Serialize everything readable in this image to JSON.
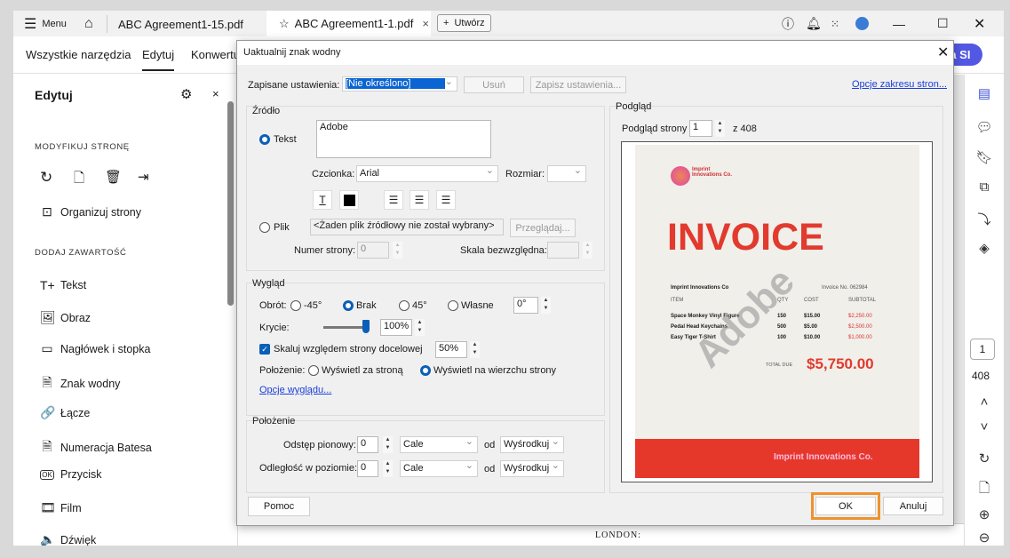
{
  "tabbar": {
    "menu": "Menu",
    "tabs": [
      {
        "label": "ABC Agreement1-15.pdf"
      },
      {
        "label": "ABC Agreement1-1.pdf"
      }
    ],
    "create": "Utwórz"
  },
  "toolbar": {
    "all_tools": "Wszystkie narzędzia",
    "edit": "Edytuj",
    "convert": "Konwertuj",
    "ai": "ta SI"
  },
  "sidebar": {
    "title": "Edytuj",
    "modify_header": "MODYFIKUJ STRONĘ",
    "organize": "Organizuj strony",
    "add_header": "DODAJ ZAWARTOŚĆ",
    "items": [
      {
        "label": "Tekst",
        "icon": "T+"
      },
      {
        "label": "Obraz",
        "icon": "🖼"
      },
      {
        "label": "Nagłówek i stopka",
        "icon": "▭"
      },
      {
        "label": "Znak wodny",
        "icon": "🗎"
      },
      {
        "label": "Łącze",
        "icon": "🔗"
      },
      {
        "label": "Numeracja Batesa",
        "icon": "🗎"
      },
      {
        "label": "Przycisk",
        "icon": "OK"
      },
      {
        "label": "Film",
        "icon": "🎞"
      },
      {
        "label": "Dźwięk",
        "icon": "🔈"
      }
    ]
  },
  "rail": {
    "page": "1",
    "total": "408"
  },
  "document": {
    "footer_text": "LONDON:"
  },
  "dialog": {
    "title": "Uaktualnij znak wodny",
    "saved_label": "Zapisane ustawienia:",
    "saved_value": "[Nie określono]",
    "delete": "Usuń",
    "save_settings": "Zapisz ustawienia...",
    "page_range_link": "Opcje zakresu stron...",
    "source": {
      "title": "Źródło",
      "text_label": "Tekst",
      "text_value": "Adobe",
      "font_label": "Czcionka:",
      "font_value": "Arial",
      "size_label": "Rozmiar:",
      "size_value": "",
      "file_label": "Plik",
      "file_value": "<Żaden plik źródłowy nie został wybrany>",
      "browse": "Przeglądaj...",
      "page_num_label": "Numer strony:",
      "page_num_value": "0",
      "scale_label": "Skala bezwzględna:",
      "scale_value": ""
    },
    "appearance": {
      "title": "Wygląd",
      "rotation_label": "Obrót:",
      "rot_options": [
        "-45°",
        "Brak",
        "45°",
        "Własne"
      ],
      "rot_custom": "0°",
      "opacity_label": "Krycie:",
      "opacity_value": "100%",
      "opacity": 1.0,
      "scale_label": "Skaluj względem strony docelowej",
      "scale_value": "50%",
      "position_label": "Położenie:",
      "behind": "Wyświetl za stroną",
      "on_top": "Wyświetl na wierzchu strony",
      "options_link": "Opcje wyglądu..."
    },
    "position": {
      "title": "Położenie",
      "vertical_label": "Odstęp pionowy:",
      "vertical_value": "0",
      "horizontal_label": "Odległość w poziomie:",
      "horizontal_value": "0",
      "unit": "Cale",
      "from": "od",
      "anchor": "Wyśrodkuj"
    },
    "preview": {
      "title": "Podgląd",
      "page_label": "Podgląd strony",
      "page_value": "1",
      "of": "z 408",
      "invoice": {
        "company_logo": "Imprint Innovations Co.",
        "heading": "INVOICE",
        "company": "Imprint Innovations Co",
        "number": "Invoice No. 062984",
        "cols": [
          "ITEM",
          "QTY",
          "COST",
          "SUBTOTAL"
        ],
        "rows": [
          [
            "Space Monkey Vinyl Figure",
            "150",
            "$15.00",
            "$2,250.00"
          ],
          [
            "Pedal Head Keychains",
            "500",
            "$5.00",
            "$2,500.00"
          ],
          [
            "Easy Tiger T-Shirt",
            "100",
            "$10.00",
            "$1,000.00"
          ]
        ],
        "total_label": "TOTAL DUE",
        "total": "$5,750.00",
        "footer": "Imprint Innovations Co.",
        "watermark": "Adobe"
      }
    },
    "help": "Pomoc",
    "ok": "OK",
    "cancel": "Anuluj"
  }
}
